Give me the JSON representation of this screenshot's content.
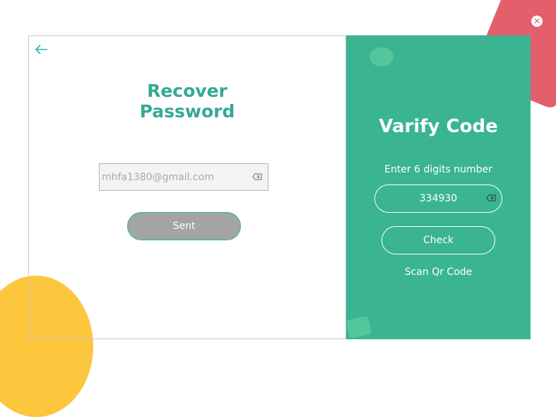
{
  "recover": {
    "title": "Recover Password",
    "email_value": "mhfa1380@gmail.com",
    "sent_label": "Sent"
  },
  "verify": {
    "title": "Varify Code",
    "instruction": "Enter 6 digits number",
    "code_value": "334930",
    "check_label": "Check",
    "scan_label": "Scan Qr Code"
  },
  "icons": {
    "back": "arrow-left-icon",
    "clear": "backspace-icon",
    "close": "close-icon"
  },
  "colors": {
    "accent": "#36a893",
    "panel": "#3ab491",
    "decor_red": "#e35f6b",
    "decor_yellow": "#fcc63d"
  }
}
